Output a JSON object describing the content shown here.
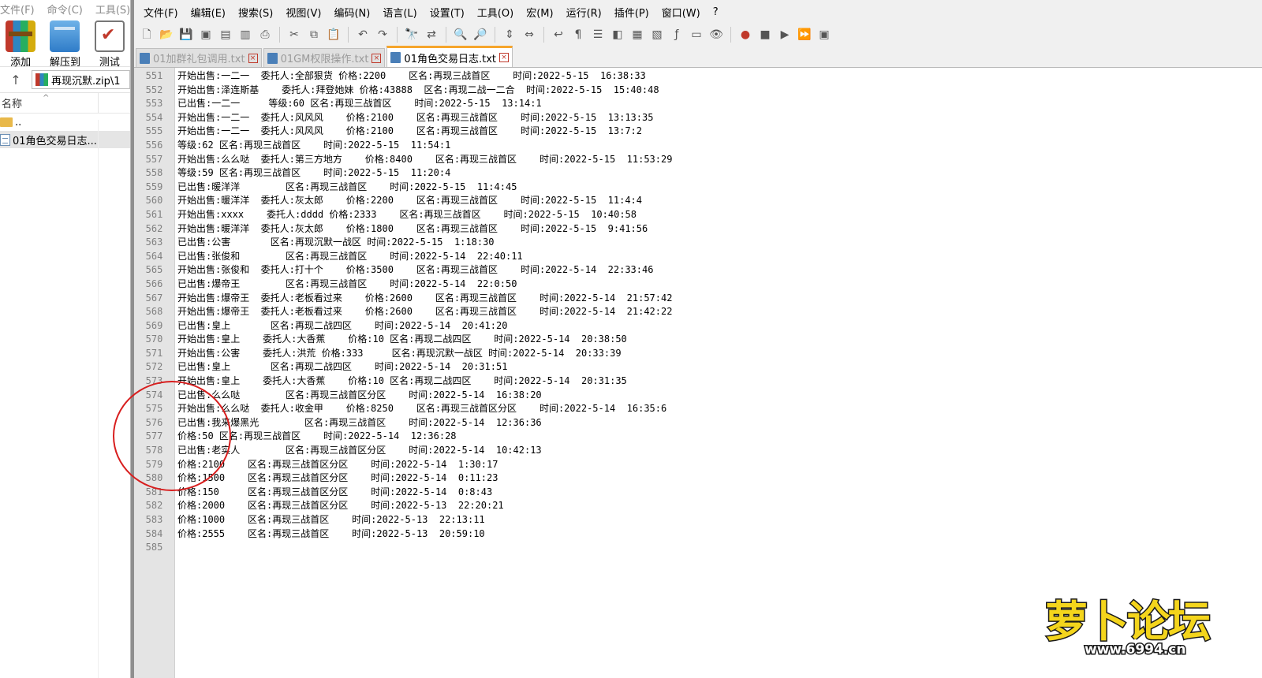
{
  "left_panel": {
    "menu": [
      "文件(F)",
      "命令(C)",
      "工具(S)"
    ],
    "tools": [
      {
        "label": "添加",
        "icon": "archive-add-icon"
      },
      {
        "label": "解压到",
        "icon": "extract-folder-icon"
      },
      {
        "label": "测试",
        "icon": "test-check-icon"
      }
    ],
    "address": "再现沉默.zip\\1",
    "column_header": "名称",
    "files": [
      {
        "name": "..",
        "icon": "folder-icon"
      },
      {
        "name": "01角色交易日志...",
        "icon": "text-file-icon"
      }
    ]
  },
  "npp": {
    "menu": [
      "文件(F)",
      "编辑(E)",
      "搜索(S)",
      "视图(V)",
      "编码(N)",
      "语言(L)",
      "设置(T)",
      "工具(O)",
      "宏(M)",
      "运行(R)",
      "插件(P)",
      "窗口(W)",
      "?"
    ],
    "tabs": [
      {
        "label": "01加群礼包调用.txt",
        "active": false
      },
      {
        "label": "01GM权限操作.txt",
        "active": false
      },
      {
        "label": "01角色交易日志.txt",
        "active": true
      }
    ],
    "lines": [
      {
        "n": "551",
        "text": "开始出售:一二一  委托人:全部狠货 价格:2200    区名:再现三战首区    时间:2022-5-15  16:38:33"
      },
      {
        "n": "552",
        "text": "开始出售:泽连斯基    委托人:拜登她妹 价格:43888  区名:再现二战一二合  时间:2022-5-15  15:40:48"
      },
      {
        "n": "553",
        "text": "已出售:一二一     等级:60 区名:再现三战首区    时间:2022-5-15  13:14:1"
      },
      {
        "n": "554",
        "text": "开始出售:一二一  委托人:风风风    价格:2100    区名:再现三战首区    时间:2022-5-15  13:13:35"
      },
      {
        "n": "555",
        "text": "开始出售:一二一  委托人:风风风    价格:2100    区名:再现三战首区    时间:2022-5-15  13:7:2"
      },
      {
        "n": "556",
        "text": "等级:62 区名:再现三战首区    时间:2022-5-15  11:54:1"
      },
      {
        "n": "557",
        "text": "开始出售:么么哒  委托人:第三方地方    价格:8400    区名:再现三战首区    时间:2022-5-15  11:53:29"
      },
      {
        "n": "558",
        "text": "等级:59 区名:再现三战首区    时间:2022-5-15  11:20:4"
      },
      {
        "n": "559",
        "text": "已出售:暖洋洋        区名:再现三战首区    时间:2022-5-15  11:4:45"
      },
      {
        "n": "560",
        "text": "开始出售:暖洋洋  委托人:灰太郎    价格:2200    区名:再现三战首区    时间:2022-5-15  11:4:4"
      },
      {
        "n": "561",
        "text": "开始出售:xxxx    委托人:dddd 价格:2333    区名:再现三战首区    时间:2022-5-15  10:40:58"
      },
      {
        "n": "562",
        "text": "开始出售:暖洋洋  委托人:灰太郎    价格:1800    区名:再现三战首区    时间:2022-5-15  9:41:56"
      },
      {
        "n": "563",
        "text": "已出售:公害       区名:再现沉默一战区 时间:2022-5-15  1:18:30"
      },
      {
        "n": "564",
        "text": "已出售:张俊和        区名:再现三战首区    时间:2022-5-14  22:40:11"
      },
      {
        "n": "565",
        "text": "开始出售:张俊和  委托人:打十个    价格:3500    区名:再现三战首区    时间:2022-5-14  22:33:46"
      },
      {
        "n": "566",
        "text": "已出售:爆帝王        区名:再现三战首区    时间:2022-5-14  22:0:50"
      },
      {
        "n": "567",
        "text": "开始出售:爆帝王  委托人:老板看过来    价格:2600    区名:再现三战首区    时间:2022-5-14  21:57:42"
      },
      {
        "n": "568",
        "text": "开始出售:爆帝王  委托人:老板看过来    价格:2600    区名:再现三战首区    时间:2022-5-14  21:42:22"
      },
      {
        "n": "569",
        "text": "已出售:皇上       区名:再现二战四区    时间:2022-5-14  20:41:20"
      },
      {
        "n": "570",
        "text": "开始出售:皇上    委托人:大香蕉    价格:10 区名:再现二战四区    时间:2022-5-14  20:38:50"
      },
      {
        "n": "571",
        "text": "开始出售:公害    委托人:洪荒 价格:333     区名:再现沉默一战区 时间:2022-5-14  20:33:39"
      },
      {
        "n": "572",
        "text": "已出售:皇上       区名:再现二战四区    时间:2022-5-14  20:31:51"
      },
      {
        "n": "573",
        "text": "开始出售:皇上    委托人:大香蕉    价格:10 区名:再现二战四区    时间:2022-5-14  20:31:35"
      },
      {
        "n": "574",
        "text": "已出售:么么哒        区名:再现三战首区分区    时间:2022-5-14  16:38:20"
      },
      {
        "n": "575",
        "text": "开始出售:么么哒  委托人:收金甲    价格:8250    区名:再现三战首区分区    时间:2022-5-14  16:35:6"
      },
      {
        "n": "576",
        "text": "已出售:我来爆黑光        区名:再现三战首区    时间:2022-5-14  12:36:36"
      },
      {
        "n": "577",
        "text": "价格:50 区名:再现三战首区    时间:2022-5-14  12:36:28"
      },
      {
        "n": "578",
        "text": "已出售:老实人        区名:再现三战首区分区    时间:2022-5-14  10:42:13"
      },
      {
        "n": "579",
        "text": "价格:2100    区名:再现三战首区分区    时间:2022-5-14  1:30:17"
      },
      {
        "n": "580",
        "text": "价格:1500    区名:再现三战首区分区    时间:2022-5-14  0:11:23"
      },
      {
        "n": "581",
        "text": "价格:150     区名:再现三战首区分区    时间:2022-5-14  0:8:43"
      },
      {
        "n": "582",
        "text": "价格:2000    区名:再现三战首区分区    时间:2022-5-13  22:20:21"
      },
      {
        "n": "583",
        "text": "价格:1000    区名:再现三战首区    时间:2022-5-13  22:13:11"
      },
      {
        "n": "584",
        "text": "价格:2555    区名:再现三战首区    时间:2022-5-13  20:59:10"
      },
      {
        "n": "585",
        "text": ""
      }
    ]
  },
  "watermark": {
    "logo_text": "萝卜论坛",
    "url": "www.6994.cn"
  },
  "colors": {
    "active_tab_accent": "#f6a52c",
    "annotation_circle": "#d81e1e",
    "watermark_yellow": "#f4d51c"
  }
}
